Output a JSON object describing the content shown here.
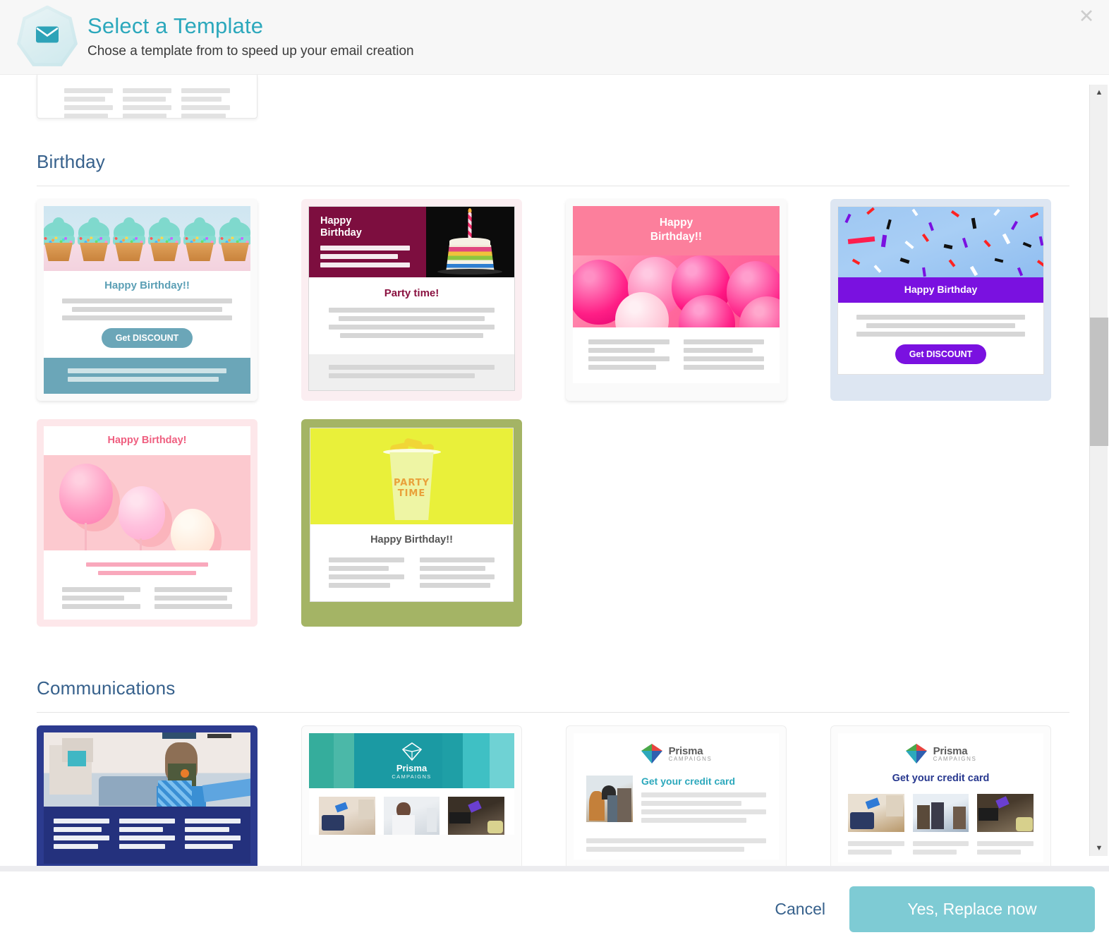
{
  "header": {
    "title": "Select a Template",
    "subtitle": "Chose a template from to speed up your email creation",
    "icon": "envelope-icon",
    "close_label": "✕",
    "accent_color": "#2ca8bc"
  },
  "sections": [
    {
      "id": "birthday",
      "title": "Birthday",
      "templates": [
        {
          "id": "cupcakes",
          "style": "cupcakes-teal",
          "headline": "Happy Birthday!!",
          "cta": "Get DISCOUNT",
          "accent": "#6ba6b8",
          "selected": false
        },
        {
          "id": "cake-maroon",
          "style": "maroon-cake",
          "banner_title": "Happy\nBirthday",
          "headline": "Party time!",
          "accent": "#7d0e3f",
          "selected": false
        },
        {
          "id": "pink-balloons",
          "style": "pink-header-balloons",
          "headline": "Happy\nBirthday!!",
          "accent": "#fc7f9c",
          "selected": false
        },
        {
          "id": "confetti-purple",
          "style": "confetti-purple",
          "headline": "Happy Birthday",
          "cta": "Get DISCOUNT",
          "accent": "#7a11e0",
          "selected": true
        },
        {
          "id": "pale-pink-balloons",
          "style": "pale-pink",
          "headline": "Happy Birthday!",
          "accent": "#ef5f80",
          "selected": false
        },
        {
          "id": "party-time-cup",
          "style": "olive-party-cup",
          "image_text": "PARTY\nTIME",
          "headline": "Happy Birthday!!",
          "accent": "#a4b465",
          "selected": true
        }
      ]
    },
    {
      "id": "communications",
      "title": "Communications",
      "templates": [
        {
          "id": "navy-lifestyle",
          "style": "navy-photo",
          "accent": "#2c3b8f",
          "selected": true
        },
        {
          "id": "prisma-teal-banner",
          "style": "teal-banner-thumbs",
          "brand_name": "Prisma",
          "brand_sub": "CAMPAIGNS",
          "accent": "#1b9aa3",
          "selected": false
        },
        {
          "id": "credit-card-teal",
          "style": "logo-left-photo",
          "brand_name": "Prisma",
          "brand_sub": "CAMPAIGNS",
          "headline": "Get your credit card",
          "accent": "#2ca8bc",
          "selected": false
        },
        {
          "id": "credit-card-navy",
          "style": "logo-three-thumbs",
          "brand_name": "Prisma",
          "brand_sub": "CAMPAIGNS",
          "headline": "Get your credit card",
          "accent": "#27388f",
          "selected": false
        }
      ]
    }
  ],
  "scrollbar": {
    "up_arrow": "▲",
    "down_arrow": "▼"
  },
  "footer": {
    "cancel_label": "Cancel",
    "confirm_label": "Yes, Replace now",
    "confirm_color": "#7ecbd4"
  }
}
